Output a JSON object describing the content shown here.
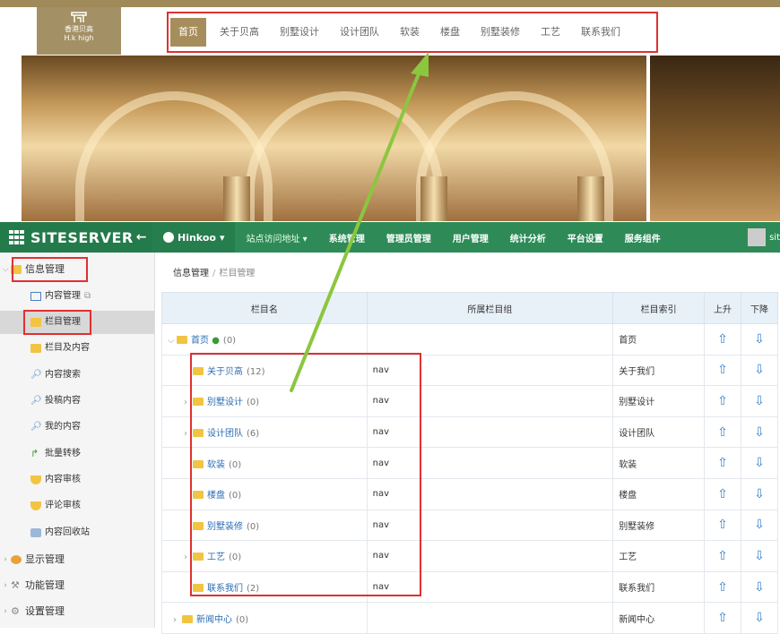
{
  "website": {
    "logo_line1": "香港贝高",
    "logo_line2": "H.k high",
    "nav": [
      "首页",
      "关于贝高",
      "别墅设计",
      "设计团队",
      "软装",
      "楼盘",
      "别墅装修",
      "工艺",
      "联系我们"
    ]
  },
  "topbar": {
    "brand": "SITESERVER",
    "site": "Hinkoo",
    "menu": [
      "站点访问地址",
      "系统管理",
      "管理员管理",
      "用户管理",
      "统计分析",
      "平台设置",
      "服务组件"
    ],
    "user": "sit"
  },
  "sidebar": {
    "groups": [
      {
        "label": "信息管理",
        "expanded": true
      },
      {
        "label": "显示管理"
      },
      {
        "label": "功能管理"
      },
      {
        "label": "设置管理"
      }
    ],
    "items": [
      "内容管理",
      "栏目管理",
      "栏目及内容",
      "内容搜索",
      "投稿内容",
      "我的内容",
      "批量转移",
      "内容审核",
      "评论审核",
      "内容回收站"
    ]
  },
  "breadcrumb": {
    "root": "信息管理",
    "sep": "/",
    "current": "栏目管理"
  },
  "table": {
    "headers": [
      "栏目名",
      "所属栏目组",
      "栏目索引",
      "上升",
      "下降"
    ],
    "rows": [
      {
        "name": "首页",
        "count": "(0)",
        "group": "",
        "index": "首页"
      },
      {
        "name": "关于贝高",
        "count": "(12)",
        "group": "nav",
        "index": "关于我们"
      },
      {
        "name": "别墅设计",
        "count": "(0)",
        "group": "nav",
        "index": "别墅设计"
      },
      {
        "name": "设计团队",
        "count": "(6)",
        "group": "nav",
        "index": "设计团队"
      },
      {
        "name": "软装",
        "count": "(0)",
        "group": "nav",
        "index": "软装"
      },
      {
        "name": "楼盘",
        "count": "(0)",
        "group": "nav",
        "index": "楼盘"
      },
      {
        "name": "别墅装修",
        "count": "(0)",
        "group": "nav",
        "index": "别墅装修"
      },
      {
        "name": "工艺",
        "count": "(0)",
        "group": "nav",
        "index": "工艺"
      },
      {
        "name": "联系我们",
        "count": "(2)",
        "group": "nav",
        "index": "联系我们"
      },
      {
        "name": "新闻中心",
        "count": "(0)",
        "group": "",
        "index": "新闻中心"
      }
    ]
  },
  "colors": {
    "green": "#2e8b57",
    "gold": "#a68e5c",
    "red": "#e03030",
    "arrow": "#8cc63f"
  }
}
